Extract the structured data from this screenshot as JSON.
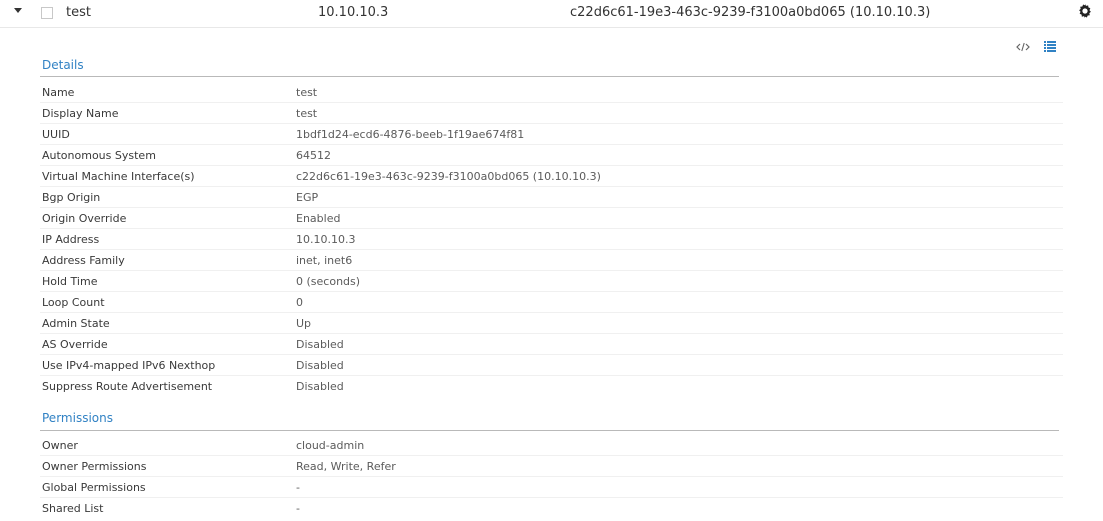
{
  "row": {
    "name": "test",
    "ip": "10.10.10.3",
    "vmi": "c22d6c61-19e3-463c-9239-f3100a0bd065 (10.10.10.3)"
  },
  "icons": {
    "expand": "caret-down-icon",
    "checkbox": "checkbox",
    "settings": "gear-icon",
    "code_view": "code-icon",
    "list_view": "list-icon"
  },
  "colors": {
    "accent": "#3182c4",
    "text": "#393939",
    "muted": "#5b5b5b"
  },
  "details": {
    "title": "Details",
    "rows": [
      {
        "label": "Name",
        "value": "test"
      },
      {
        "label": "Display Name",
        "value": "test"
      },
      {
        "label": "UUID",
        "value": "1bdf1d24-ecd6-4876-beeb-1f19ae674f81"
      },
      {
        "label": "Autonomous System",
        "value": "64512"
      },
      {
        "label": "Virtual Machine Interface(s)",
        "value": "c22d6c61-19e3-463c-9239-f3100a0bd065 (10.10.10.3)"
      },
      {
        "label": "Bgp Origin",
        "value": "EGP"
      },
      {
        "label": "Origin Override",
        "value": "Enabled"
      },
      {
        "label": "IP Address",
        "value": "10.10.10.3"
      },
      {
        "label": "Address Family",
        "value": "inet, inet6"
      },
      {
        "label": "Hold Time",
        "value": "0 (seconds)"
      },
      {
        "label": "Loop Count",
        "value": "0"
      },
      {
        "label": "Admin State",
        "value": "Up"
      },
      {
        "label": "AS Override",
        "value": "Disabled"
      },
      {
        "label": "Use IPv4-mapped IPv6 Nexthop",
        "value": "Disabled"
      },
      {
        "label": "Suppress Route Advertisement",
        "value": "Disabled"
      }
    ]
  },
  "permissions": {
    "title": "Permissions",
    "rows": [
      {
        "label": "Owner",
        "value": "cloud-admin"
      },
      {
        "label": "Owner Permissions",
        "value": "Read, Write, Refer"
      },
      {
        "label": "Global Permissions",
        "value": "-"
      },
      {
        "label": "Shared List",
        "value": "-"
      }
    ]
  }
}
